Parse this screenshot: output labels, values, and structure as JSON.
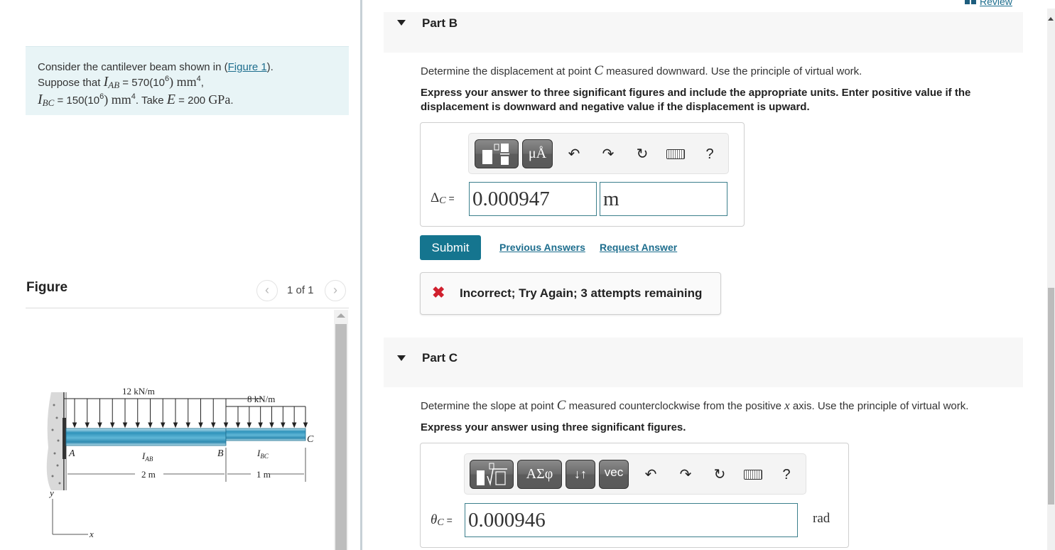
{
  "problem": {
    "intro": "Consider the cantilever beam shown in (",
    "figure_link": "Figure 1",
    "intro_end": ").",
    "suppose": "Suppose that ",
    "I_AB_symbol": "I",
    "I_AB_sub": "AB",
    "I_AB_value": " = 570(10",
    "exp": "6",
    "close_paren": ") ",
    "unit_mm": "mm",
    "unit_exp": "4",
    "comma": ",",
    "I_BC_symbol": "I",
    "I_BC_sub": "BC",
    "I_BC_value": " = 150(10",
    "take": ". Take ",
    "E_symbol": "E",
    "E_value": " = 200 ",
    "E_unit": "GPa",
    "period": "."
  },
  "figure": {
    "title": "Figure",
    "pager": "1 of 1",
    "prev_icon": "chevron-left-icon",
    "next_icon": "chevron-right-icon",
    "labels": {
      "load_ab": "12 kN/m",
      "load_bc": "8 kN/m",
      "point_a": "A",
      "point_b": "B",
      "point_c": "C",
      "i_ab": "I",
      "i_ab_sub": "AB",
      "i_bc": "I",
      "i_bc_sub": "BC",
      "len_ab": "2 m",
      "len_bc": "1 m",
      "axis_y": "y",
      "axis_x": "x"
    }
  },
  "header": {
    "review_label": "Review",
    "review_icon": "book-icon"
  },
  "partB": {
    "title": "Part B",
    "question_pre": "Determine the displacement at point ",
    "question_var": "C",
    "question_post": " measured downward. Use the principle of virtual work.",
    "instruction": "Express your answer to three significant figures and include the appropriate units. Enter positive value if the displacement is downward and negative value if the displacement is upward.",
    "toolbar": {
      "templates_icon": "templates-icon",
      "units_label": "μÅ",
      "undo_icon": "undo-icon",
      "redo_icon": "redo-icon",
      "reset_icon": "reset-icon",
      "keyboard_icon": "keyboard-icon",
      "help_label": "?"
    },
    "eq_symbol": "Δ",
    "eq_sub": "C",
    "eq_equals": " =",
    "value": "0.000947",
    "unit": "m",
    "submit_label": "Submit",
    "previous_answers_label": "Previous Answers",
    "request_answer_label": "Request Answer",
    "feedback": {
      "icon": "x",
      "message": "Incorrect; Try Again; 3 attempts remaining",
      "color": "#d0202e"
    }
  },
  "partC": {
    "title": "Part C",
    "question_pre": "Determine the slope at point ",
    "question_var": "C",
    "question_mid": " measured counterclockwise from the positive ",
    "question_var2": "x",
    "question_post": " axis. Use the principle of virtual work.",
    "instruction": "Express your answer using three significant figures.",
    "toolbar": {
      "templates_icon": "radical-template-icon",
      "greek_label": "ΑΣφ",
      "arrows_label": "↓↑",
      "vec_label": "vec",
      "undo_icon": "undo-icon",
      "redo_icon": "redo-icon",
      "reset_icon": "reset-icon",
      "keyboard_icon": "keyboard-icon",
      "help_label": "?"
    },
    "eq_symbol": "θ",
    "eq_sub": "C",
    "eq_equals": " =",
    "value": "0.000946",
    "unit": "rad"
  },
  "colors": {
    "accent": "#15758f",
    "link": "#1e6e8e",
    "problem_bg": "#e8f4f6",
    "beam": "#3a9fc4",
    "error": "#d0202e"
  }
}
